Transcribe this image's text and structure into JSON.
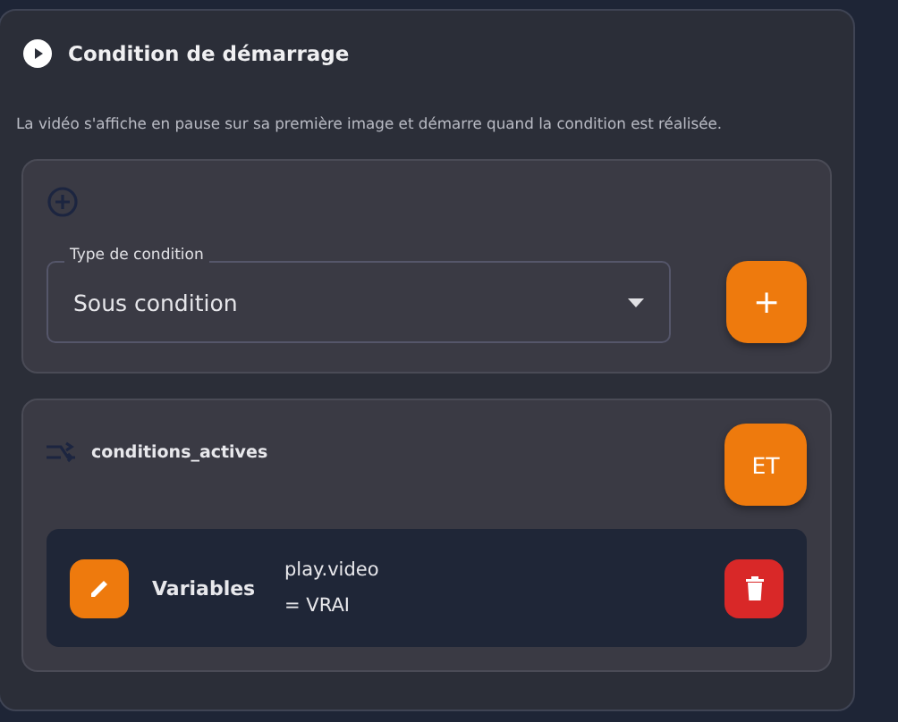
{
  "section": {
    "title": "Condition de démarrage",
    "description": "La vidéo s'affiche en pause sur sa première image et démarre quand la condition est réalisée."
  },
  "condition_type": {
    "label": "Type de condition",
    "value": "Sous condition",
    "add_button": "+"
  },
  "active_conditions": {
    "title": "conditions_actives",
    "operator_button": "ET",
    "items": [
      {
        "type": "Variables",
        "expression": [
          "play.video",
          "= VRAI"
        ]
      }
    ]
  }
}
